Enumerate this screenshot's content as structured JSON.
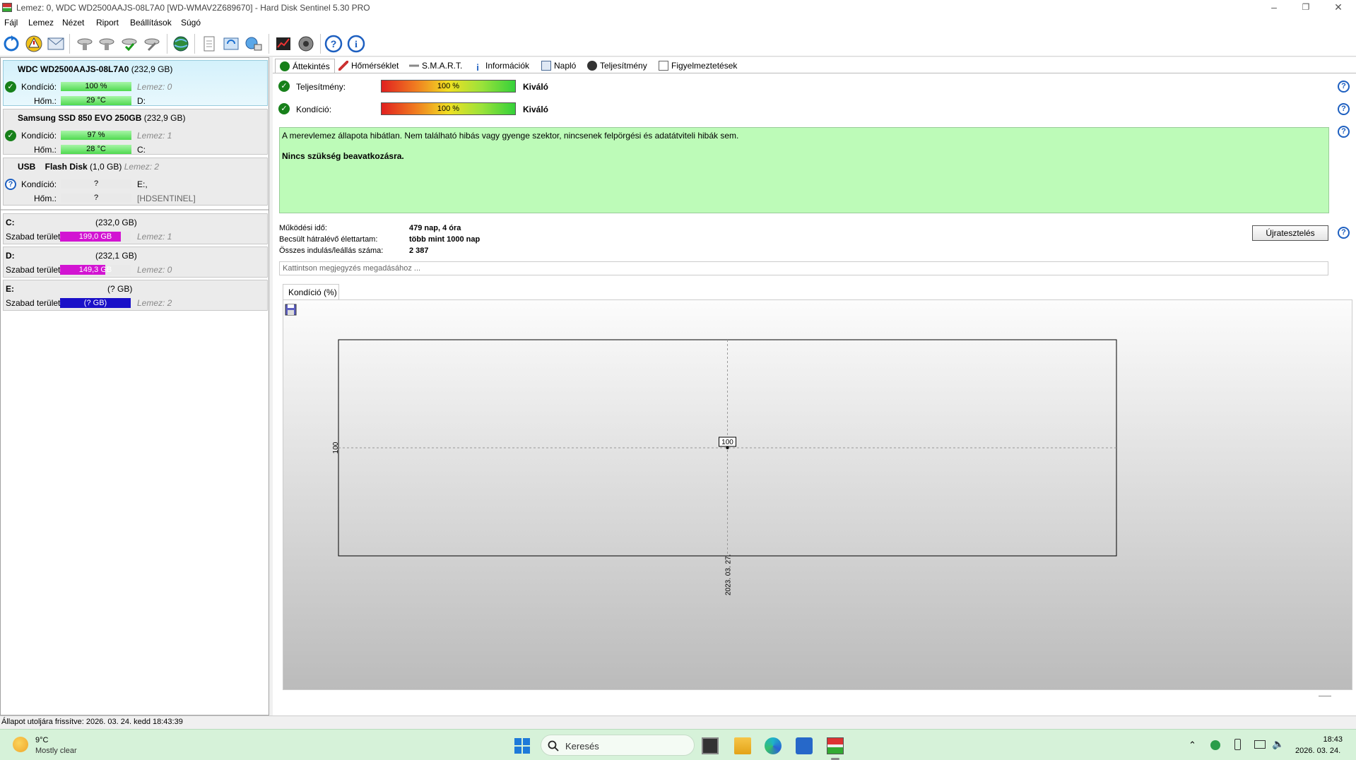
{
  "window": {
    "title": "Lemez: 0, WDC WD2500AAJS-08L7A0 [WD-WMAV2Z689670]  -  Hard Disk Sentinel 5.30 PRO",
    "minimize": "–",
    "maximize": "❐",
    "close": "✕"
  },
  "menu": [
    "Fájl",
    "Lemez",
    "Nézet",
    "Riport",
    "Beállítások",
    "Súgó"
  ],
  "disks": [
    {
      "name": "WDC WD2500AAJS-08L7A0",
      "size": "(232,9 GB)",
      "condition_label": "Kondíció:",
      "condition": "100 %",
      "condition_fraction": 1.0,
      "disk_ref": "Lemez: 0",
      "temp_label": "Hőm.:",
      "temp": "29 °C",
      "drive_letter": "D:",
      "status_icon": "ok-checkmark-icon"
    },
    {
      "name": "Samsung SSD 850 EVO 250GB",
      "size": "(232,9 GB)",
      "condition_label": "Kondíció:",
      "condition": "97 %",
      "condition_fraction": 0.97,
      "disk_ref": "Lemez: 1",
      "temp_label": "Hőm.:",
      "temp": "28 °C",
      "drive_letter": "C:",
      "status_icon": "ok-checkmark-icon"
    },
    {
      "name": "USB    Flash Disk",
      "size": "(1,0 GB)",
      "disk_ref_inline": "Lemez: 2",
      "condition_label": "Kondíció:",
      "condition": "?",
      "temp_label": "Hőm.:",
      "temp": "?",
      "drive_letter": "E:,",
      "volume_label": "[HDSENTINEL]",
      "status_icon": "question-icon"
    }
  ],
  "volumes": [
    {
      "letter": "C:",
      "size": "(232,0 GB)",
      "free_label": "Szabad terület",
      "free": "199,0 GB",
      "free_fraction": 0.858,
      "disk_ref": "Lemez: 1",
      "color": "#d214d2"
    },
    {
      "letter": "D:",
      "size": "(232,1 GB)",
      "free_label": "Szabad terület",
      "free": "149,3 GB",
      "free_fraction": 0.643,
      "disk_ref": "Lemez: 0",
      "color": "#d214d2"
    },
    {
      "letter": "E:",
      "size": "(? GB)",
      "free_label": "Szabad terület",
      "free": "(? GB)",
      "free_fraction": 1.0,
      "disk_ref": "Lemez: 2",
      "color": "#1a10c8"
    }
  ],
  "tabs": [
    "Áttekintés",
    "Hőmérséklet",
    "S.M.A.R.T.",
    "Információk",
    "Napló",
    "Teljesítmény",
    "Figyelmeztetések"
  ],
  "overview": {
    "performance_label": "Teljesítmény:",
    "performance_value": "100 %",
    "performance_fraction": 1.0,
    "performance_rating": "Kiváló",
    "condition_label": "Kondíció:",
    "condition_value": "100 %",
    "condition_fraction": 1.0,
    "condition_rating": "Kiváló",
    "status_text": "A merevlemez állapota hibátlan. Nem található hibás vagy gyenge szektor, nincsenek felpörgési és adatátviteli hibák sem.",
    "status_action": "Nincs szükség beavatkozásra.",
    "uptime_label": "Működési idő:",
    "uptime_value": "479 nap, 4 óra",
    "lifetime_label": "Becsült hátralévő élettartam:",
    "lifetime_value": "több mint 1000 nap",
    "starts_label": "Összes indulás/leállás száma:",
    "starts_value": "2 387",
    "retest_button": "Újratesztelés",
    "note_placeholder": "Kattintson megjegyzés megadásához ..."
  },
  "chart_tab": "Kondíció  (%)",
  "chart_data": {
    "type": "line",
    "x": [
      "2023. 03. 27."
    ],
    "series": [
      {
        "values": [
          100
        ]
      }
    ],
    "data_labels": [
      "100"
    ],
    "ytick": "100",
    "xtick": "2023. 03. 27.",
    "grid": true
  },
  "statusbar": "Állapot utoljára frissítve: 2026. 03. 24. kedd 18:43:39",
  "taskbar": {
    "weather_temp": "9°C",
    "weather_desc": "Mostly clear",
    "search_placeholder": "Keresés",
    "time": "18:43",
    "date": "2026. 03. 24."
  }
}
